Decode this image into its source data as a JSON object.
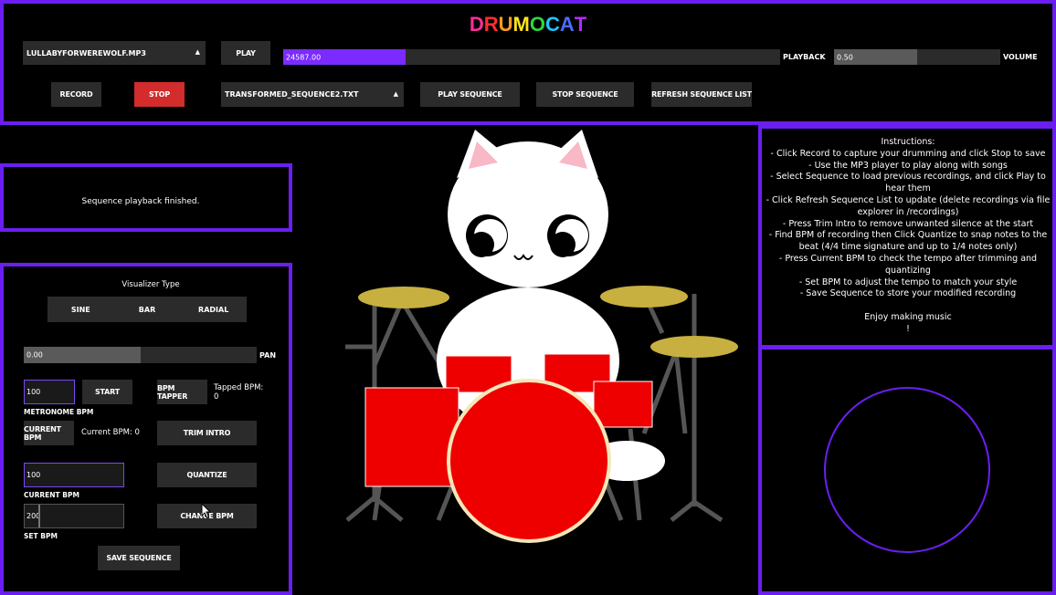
{
  "app": {
    "title_letters": [
      "D",
      "R",
      "U",
      "M",
      "O",
      "C",
      "A",
      "T"
    ],
    "title_colors": [
      "#ff2d9b",
      "#ff2d2d",
      "#ff9a1f",
      "#ffe31a",
      "#2dd63c",
      "#1fc4ff",
      "#4b6bff",
      "#b02dff"
    ]
  },
  "header": {
    "song_select": {
      "value": "LULLABYFORWEREWOLF.MP3",
      "arrow": "▲"
    },
    "play_label": "PLAY",
    "playback": {
      "value": "24587.00",
      "fraction": 0.246,
      "label": "PLAYBACK"
    },
    "volume": {
      "value": "0.50",
      "fraction": 0.5,
      "label": "VOLUME"
    },
    "record_label": "RECORD",
    "stop_label": "STOP",
    "sequence_select": {
      "value": "TRANSFORMED_SEQUENCE2.TXT",
      "arrow": "▲"
    },
    "play_sequence_label": "PLAY SEQUENCE",
    "stop_sequence_label": "STOP SEQUENCE",
    "refresh_label": "REFRESH SEQUENCE LIST"
  },
  "status": {
    "message": "Sequence playback finished."
  },
  "controls": {
    "visualizer_title": "Visualizer Type",
    "visualizer_options": [
      "SINE",
      "BAR",
      "RADIAL"
    ],
    "pan": {
      "value": "0.00",
      "fraction": 0.5,
      "label": "PAN"
    },
    "metronome_value": "100",
    "metronome_label": "METRONOME BPM",
    "start_label": "START",
    "bpm_tapper_label": "BPM TAPPER",
    "tapped_bpm": "Tapped BPM: 0",
    "current_bpm_button": "CURRENT BPM",
    "current_bpm_text": "Current BPM: 0",
    "trim_intro_label": "TRIM INTRO",
    "current_bpm_input": "100",
    "current_bpm_input_label": "CURRENT BPM",
    "quantize_label": "QUANTIZE",
    "set_bpm_value": "200",
    "set_bpm_label": "SET BPM",
    "change_bpm_label": "CHANGE BPM",
    "save_label": "SAVE SEQUENCE"
  },
  "instructions": {
    "lines": [
      "Instructions:",
      "- Click Record to capture your drumming and click Stop to save",
      "- Use the MP3 player to play along with songs",
      "- Select Sequence to load previous recordings, and click Play to hear them",
      "- Click Refresh Sequence List to update (delete recordings via file explorer in /recordings)",
      "- Press Trim Intro to remove unwanted silence at the start",
      "- Find BPM of recording then Click Quantize to snap notes to the beat (4/4 time signature and up to 1/4 notes only)",
      "- Press Current BPM to check the tempo after trimming and quantizing",
      "- Set BPM to adjust the tempo to match your style",
      "- Save Sequence to store your modified recording",
      "",
      "Enjoy making music",
      "!"
    ]
  },
  "colors": {
    "accent": "#6a1ff0",
    "fill": "#7b2bff",
    "stop": "#d22c2c",
    "drum": "#ee0000",
    "cymbal": "#c8b040"
  }
}
